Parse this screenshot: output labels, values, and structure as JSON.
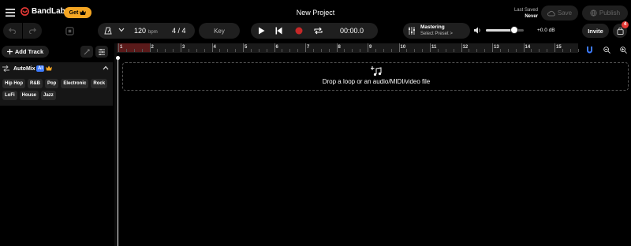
{
  "app": {
    "name": "BandLab",
    "get_label": "Get",
    "project_title": "New Project"
  },
  "status": {
    "last_saved_label": "Last Saved",
    "last_saved_value": "Never"
  },
  "header": {
    "save_label": "Save",
    "publish_label": "Publish"
  },
  "transport": {
    "tempo": "120",
    "tempo_unit": "bpm",
    "time_signature": "4 / 4",
    "key_label": "Key",
    "time": "00:00.0"
  },
  "mastering": {
    "title": "Mastering",
    "subtitle": "Select Preset >"
  },
  "volume": {
    "level": 0.75,
    "db": "+0.0 dB"
  },
  "invite_label": "Invite",
  "notifications": {
    "count": "4"
  },
  "tracks": {
    "add_label": "Add Track"
  },
  "automix": {
    "label": "AutoMix",
    "ai_badge": "AI",
    "genres_row1": [
      "Hip Hop",
      "R&B",
      "Pop",
      "Electronic",
      "Rock"
    ],
    "genres_row2": [
      "LoFi",
      "House",
      "Jazz"
    ]
  },
  "timeline": {
    "bars": [
      "1",
      "2",
      "3",
      "4",
      "5",
      "6",
      "7",
      "8",
      "9",
      "10",
      "11",
      "12",
      "13",
      "14",
      "15"
    ]
  },
  "drop_zone": {
    "text": "Drop a loop or an audio/MIDI/video file"
  },
  "colors": {
    "accent": "#f5a623",
    "record": "#c62828",
    "loop_region": "#5a1a1a",
    "ai_badge": "#3d7bff",
    "magnet": "#3d7bff"
  }
}
